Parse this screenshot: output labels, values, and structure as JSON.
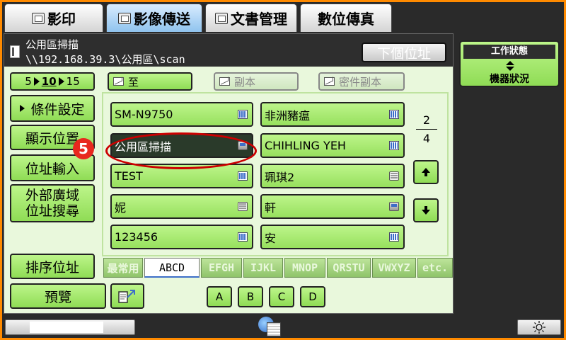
{
  "mode_tabs": [
    {
      "label": "影印",
      "active": false
    },
    {
      "label": "影像傳送",
      "active": true
    },
    {
      "label": "文書管理",
      "active": false
    },
    {
      "label": "數位傳真",
      "active": false
    }
  ],
  "header": {
    "title": "公用區掃描",
    "path": "\\\\192.168.39.3\\公用區\\scan",
    "next_address_label": "下個位址"
  },
  "counter": {
    "a": "5",
    "b": "10",
    "c": "15"
  },
  "recipient_buttons": {
    "to": "至",
    "cc": "副本",
    "bcc": "密件副本"
  },
  "side_buttons": {
    "conditions": "條件設定",
    "show_position": "顯示位置",
    "address_input": "位址輸入",
    "global_search_line1": "外部廣域",
    "global_search_line2": "位址搜尋",
    "sort": "排序位址",
    "preview": "預覽"
  },
  "addresses": [
    {
      "name": "SM-N9750",
      "type": "grid",
      "selected": false
    },
    {
      "name": "非洲豬瘟",
      "type": "grid",
      "selected": false
    },
    {
      "name": "公用區掃描",
      "type": "folder",
      "selected": true
    },
    {
      "name": "CHIHLING YEH",
      "type": "grid",
      "selected": false
    },
    {
      "name": "TEST",
      "type": "grid",
      "selected": false
    },
    {
      "name": "珮琪2",
      "type": "stack",
      "selected": false
    },
    {
      "name": "妮",
      "type": "stack",
      "selected": false
    },
    {
      "name": "軒",
      "type": "folder",
      "selected": false
    },
    {
      "name": "123456",
      "type": "grid",
      "selected": false
    },
    {
      "name": "安",
      "type": "grid",
      "selected": false
    }
  ],
  "page_indicator": {
    "current": "2",
    "total": "4"
  },
  "index_tabs": [
    "最常用",
    "ABCD",
    "EFGH",
    "IJKL",
    "MNOP",
    "QRSTU",
    "VWXYZ",
    "etc."
  ],
  "active_index_tab": "ABCD",
  "letter_buttons": [
    "A",
    "B",
    "C",
    "D"
  ],
  "annotation": {
    "step": "5"
  },
  "status_panel": {
    "title": "工作狀態",
    "subtitle": "機器狀況"
  },
  "colors": {
    "accent_green": "#8fdc55",
    "frame_orange": "#ff8a00",
    "highlight_red": "#c00000"
  }
}
